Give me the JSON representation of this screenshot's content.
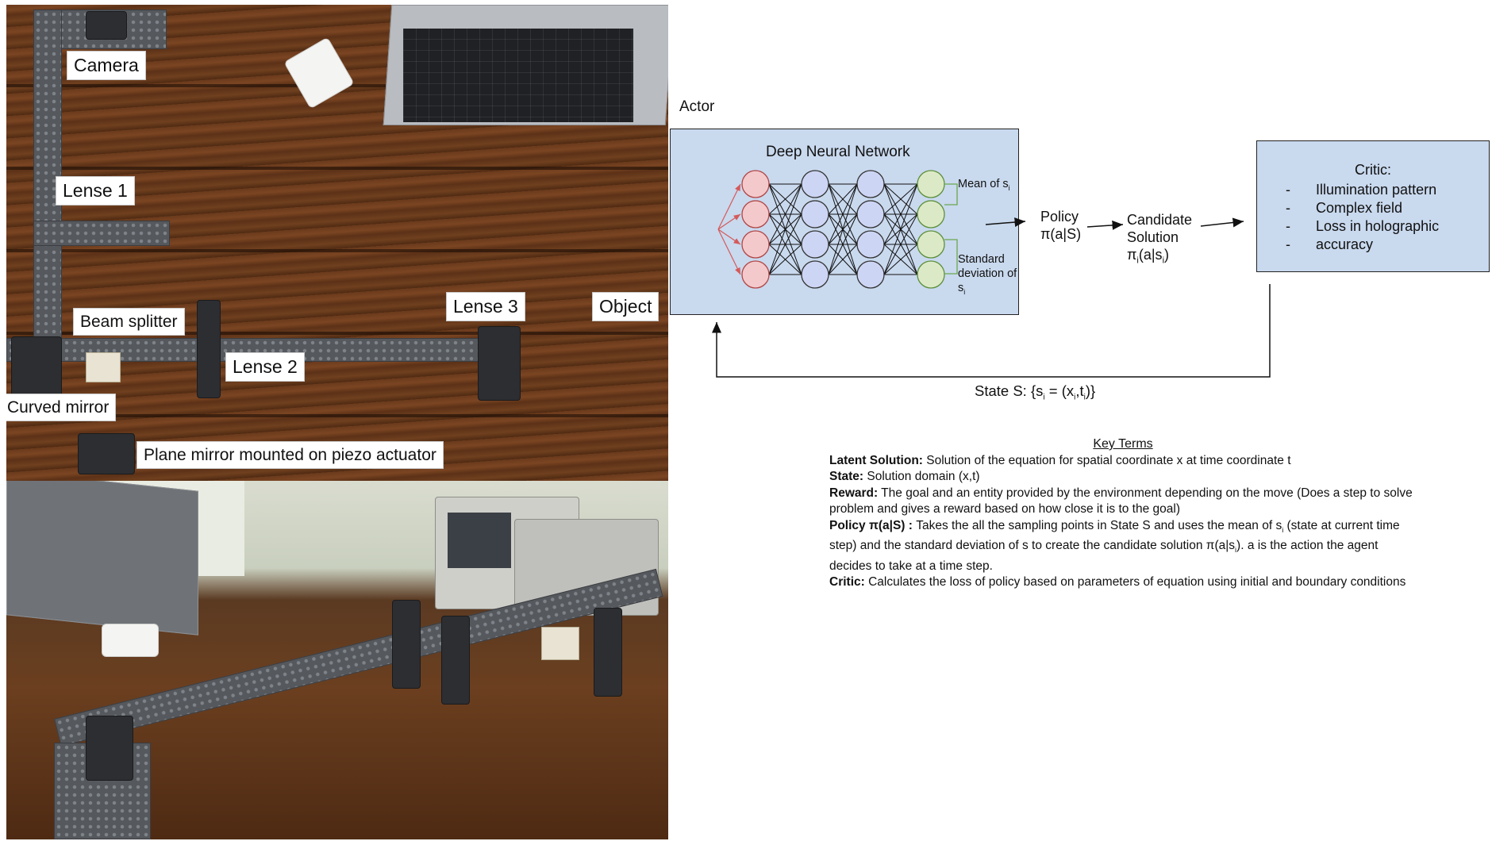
{
  "photo_top": {
    "labels": {
      "camera": "Camera",
      "lense1": "Lense 1",
      "beam_splitter": "Beam splitter",
      "lense2": "Lense 2",
      "lense3": "Lense 3",
      "object": "Object",
      "curved_mirror": "Curved mirror",
      "plane_mirror": "Plane mirror mounted on piezo actuator"
    }
  },
  "diagram": {
    "actor_label": "Actor",
    "network_title": "Deep Neural Network",
    "mean_label": "Mean of s",
    "mean_sub": "i",
    "std_label_1": "Standard",
    "std_label_2": "deviation of",
    "std_label_3": "s",
    "std_sub": "i",
    "policy_1": "Policy",
    "policy_2": "π(a|S)",
    "candidate_1": "Candidate",
    "candidate_2": "Solution",
    "candidate_3": "π",
    "candidate_3_sub": "i",
    "candidate_3_rest": "(a|s",
    "candidate_3_sub2": "i",
    "candidate_3_end": ")",
    "critic_title": "Critic:",
    "critic_items": [
      "Illumination pattern",
      "Complex field",
      "Loss in holographic",
      "accuracy"
    ],
    "state_label_pre": "State S: {s",
    "state_sub1": "i",
    "state_mid": " = (x",
    "state_sub2": "i",
    "state_comma": ",t",
    "state_sub3": "i",
    "state_end": ")}"
  },
  "key_terms": {
    "title": "Key Terms",
    "latent_term": "Latent Solution:",
    "latent_def": " Solution of the equation for spatial coordinate x at time coordinate t",
    "state_term": "State:",
    "state_def": " Solution domain (x,t)",
    "reward_term": "Reward:",
    "reward_def": " The goal and an entity provided by the environment depending on the move (Does a step to solve problem and gives a reward based on how close it is to the goal)",
    "policy_term": "Policy π(a|S) :",
    "policy_def": " Takes the all the sampling points in State S and uses the mean of s",
    "policy_sub": "i",
    "policy_def2": " (state at current time step) and the standard deviation of s to create the candidate solution π(a|s",
    "policy_sub2": "i",
    "policy_def3": "). a is the action the agent decides to take at a time step.",
    "critic_term": "Critic:",
    "critic_def": " Calculates the loss of policy based on parameters of equation using initial and boundary conditions"
  },
  "colors": {
    "box_fill": "#c9d9ee",
    "input_node": "#f3c9cb",
    "hidden_node": "#cdd5f4",
    "output_node": "#dce9c6",
    "input_arrow": "#d45a5a"
  }
}
